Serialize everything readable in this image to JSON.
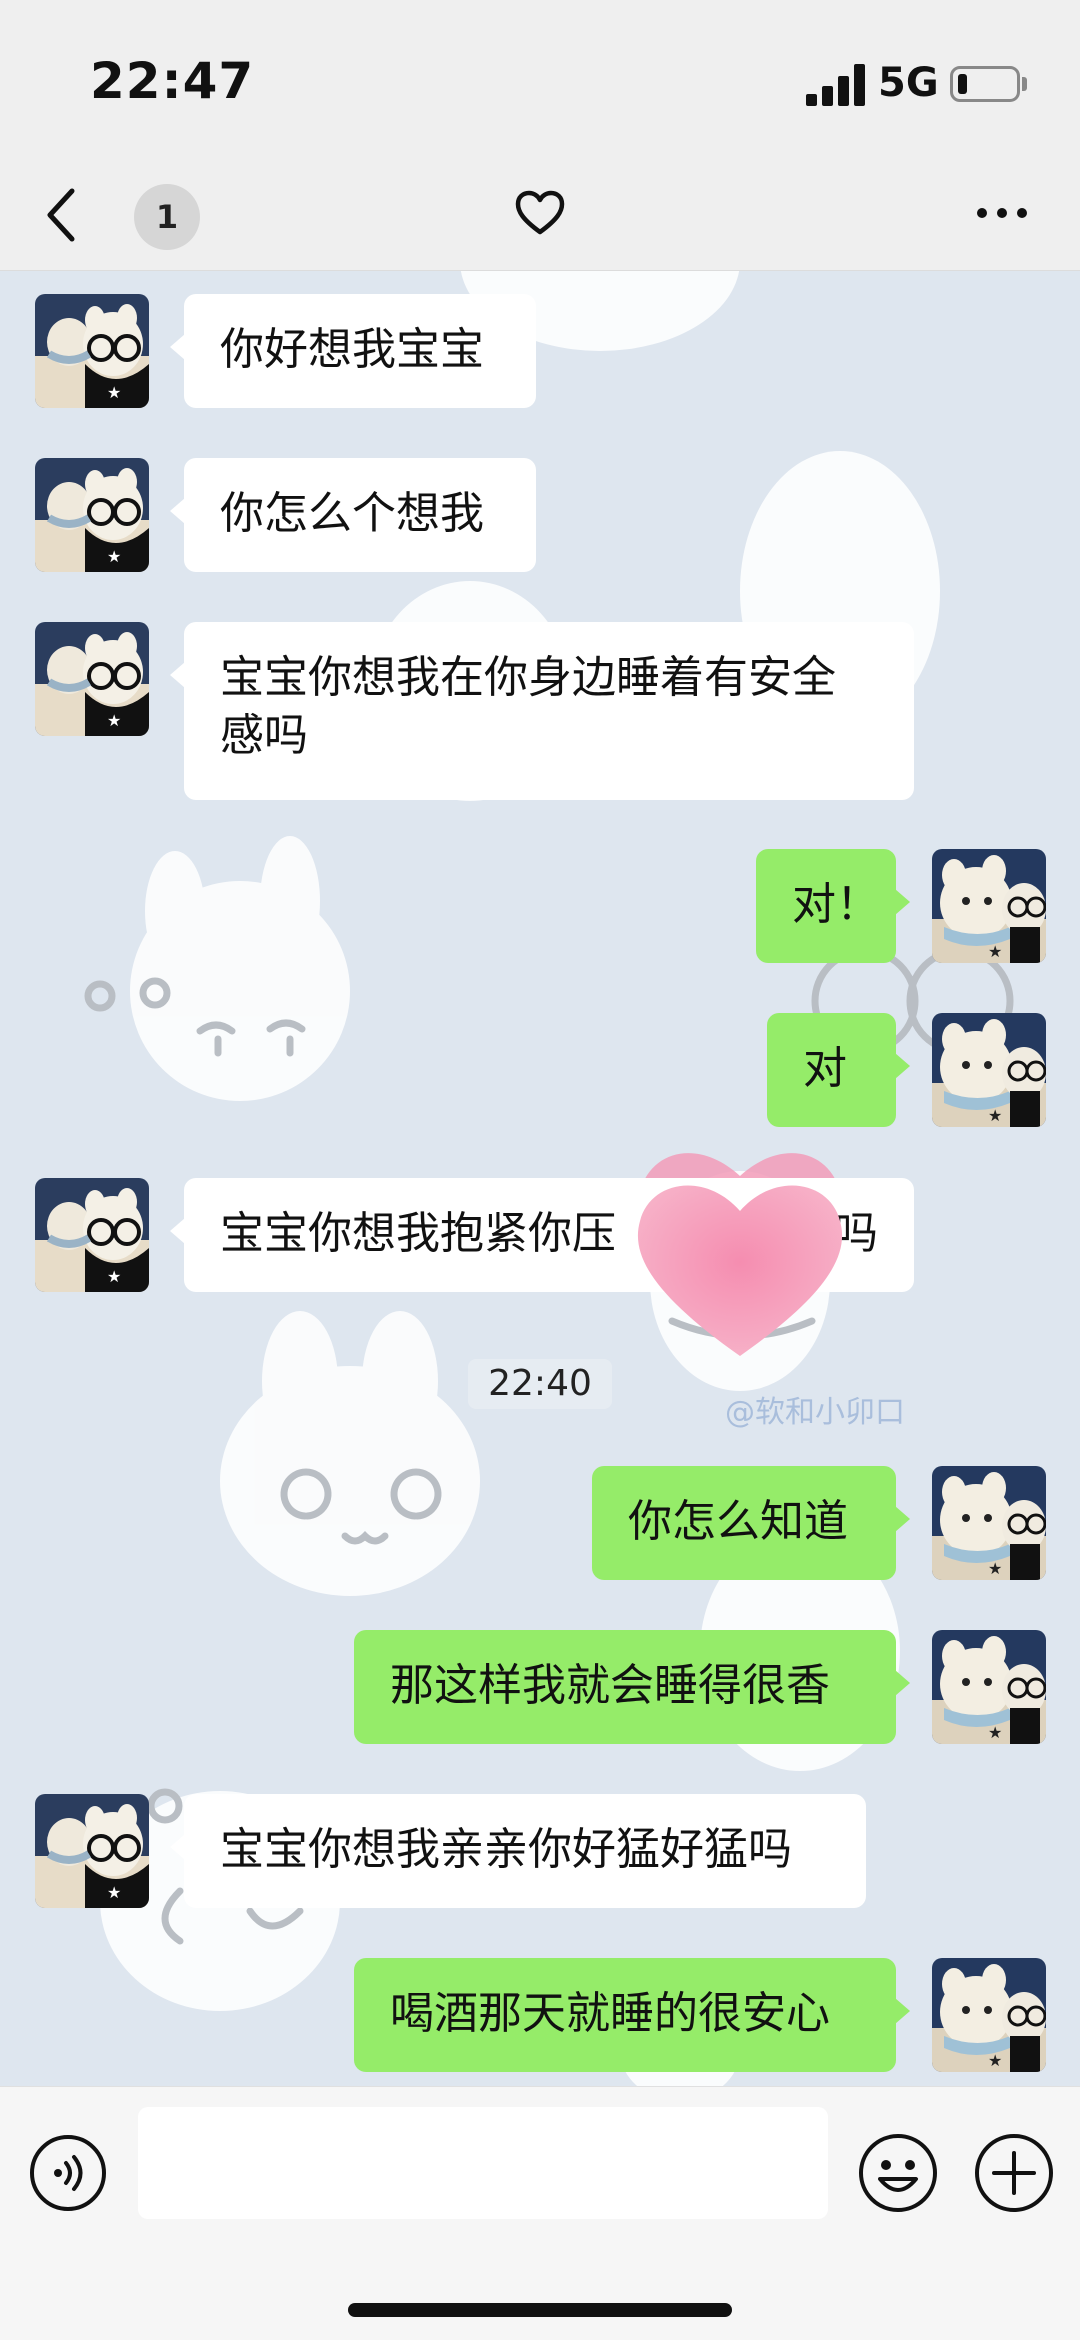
{
  "status_bar": {
    "time": "22:47",
    "network": "5G",
    "battery_level": 0.15
  },
  "nav": {
    "unread_count": "1",
    "icons": [
      "back-chevron-icon",
      "heart-icon",
      "more-dots-icon"
    ]
  },
  "messages": [
    {
      "side": "in",
      "text": "你好想我宝宝"
    },
    {
      "side": "in",
      "text": "你怎么个想我"
    },
    {
      "side": "in",
      "text": "宝宝你想我在你身边睡着有安全感吗"
    },
    {
      "side": "out",
      "text": "对！"
    },
    {
      "side": "out",
      "text": "对"
    },
    {
      "side": "in",
      "text": "宝宝你想我抱紧你压",
      "text_tail": "吗"
    },
    {
      "side": "out",
      "text": "你怎么知道"
    },
    {
      "side": "out",
      "text": "那这样我就会睡得很香"
    },
    {
      "side": "in",
      "text": "宝宝你想我亲亲你好猛好猛吗"
    },
    {
      "side": "out",
      "text": "喝酒那天就睡的很安心"
    }
  ],
  "timestamp": "22:40",
  "watermark": "@软和小卯口",
  "colors": {
    "outgoing_bubble": "#95ec69",
    "incoming_bubble": "#ffffff",
    "chat_background": "#dee6ef"
  },
  "input_bar": {
    "icons": [
      "voice-icon",
      "emoji-icon",
      "plus-icon"
    ],
    "input_value": ""
  }
}
